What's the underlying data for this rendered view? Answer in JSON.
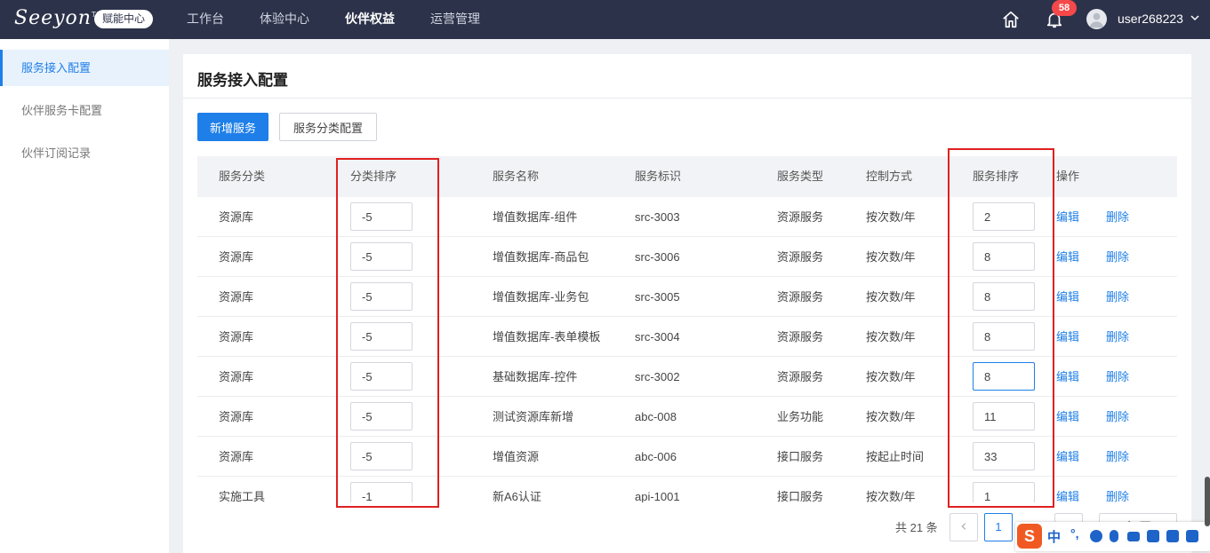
{
  "topbar": {
    "logo_text": "Seeyon",
    "logo_tm": "TM",
    "logo_badge": "赋能中心",
    "nav": [
      "工作台",
      "体验中心",
      "伙伴权益",
      "运营管理"
    ],
    "active_nav": "伙伴权益",
    "notification_count": "58",
    "username": "user268223"
  },
  "sidebar": {
    "items": [
      {
        "label": "服务接入配置",
        "active": true
      },
      {
        "label": "伙伴服务卡配置",
        "active": false
      },
      {
        "label": "伙伴订阅记录",
        "active": false
      }
    ]
  },
  "page": {
    "title": "服务接入配置",
    "add_button": "新增服务",
    "category_button": "服务分类配置"
  },
  "table": {
    "headers": {
      "category": "服务分类",
      "category_order": "分类排序",
      "name": "服务名称",
      "identifier": "服务标识",
      "type": "服务类型",
      "control": "控制方式",
      "order": "服务排序",
      "actions": "操作"
    },
    "edit_label": "编辑",
    "delete_label": "删除",
    "rows": [
      {
        "category": "资源库",
        "category_order": "-5",
        "name": "增值数据库-组件",
        "identifier": "src-3003",
        "type": "资源服务",
        "control": "按次数/年",
        "order": "2"
      },
      {
        "category": "资源库",
        "category_order": "-5",
        "name": "增值数据库-商品包",
        "identifier": "src-3006",
        "type": "资源服务",
        "control": "按次数/年",
        "order": "8"
      },
      {
        "category": "资源库",
        "category_order": "-5",
        "name": "增值数据库-业务包",
        "identifier": "src-3005",
        "type": "资源服务",
        "control": "按次数/年",
        "order": "8"
      },
      {
        "category": "资源库",
        "category_order": "-5",
        "name": "增值数据库-表单模板",
        "identifier": "src-3004",
        "type": "资源服务",
        "control": "按次数/年",
        "order": "8"
      },
      {
        "category": "资源库",
        "category_order": "-5",
        "name": "基础数据库-控件",
        "identifier": "src-3002",
        "type": "资源服务",
        "control": "按次数/年",
        "order": "8"
      },
      {
        "category": "资源库",
        "category_order": "-5",
        "name": "测试资源库新增",
        "identifier": "abc-008",
        "type": "业务功能",
        "control": "按次数/年",
        "order": "11"
      },
      {
        "category": "资源库",
        "category_order": "-5",
        "name": "增值资源",
        "identifier": "abc-006",
        "type": "接口服务",
        "control": "按起止时间",
        "order": "33"
      },
      {
        "category": "实施工具",
        "category_order": "-1",
        "name": "新A6认证",
        "identifier": "api-1001",
        "type": "接口服务",
        "control": "按次数/年",
        "order": "1"
      }
    ]
  },
  "pagination": {
    "total": "共 21 条",
    "current_page": "1",
    "page_size": "20 条/页"
  },
  "ime": {
    "logo": "S",
    "mode": "中"
  },
  "colors": {
    "topbar": "#2c3249",
    "primary": "#1f7fe8",
    "highlight_box": "#e02020"
  }
}
